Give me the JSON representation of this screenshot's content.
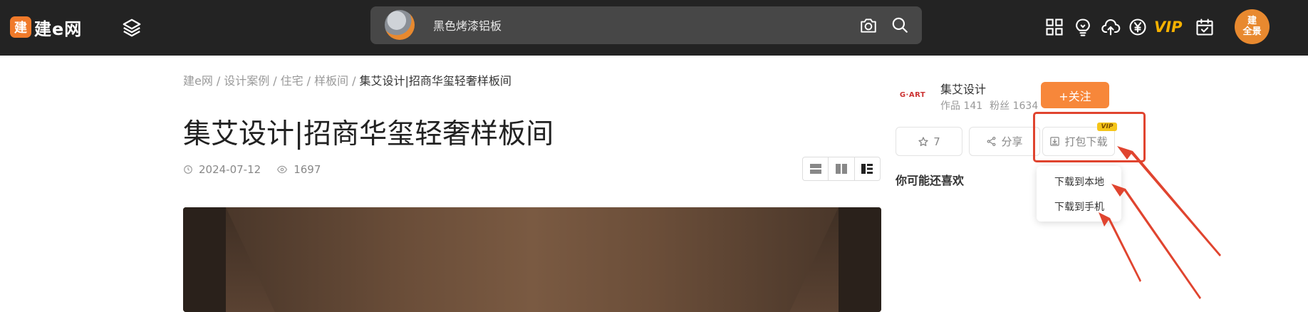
{
  "header": {
    "logo_mark": "建",
    "logo_text": "建e网",
    "search_value": "黑色烤漆铝板",
    "vip_label": "VIP",
    "avatar_text_line1": "建",
    "avatar_text_line2": "全景"
  },
  "breadcrumb": {
    "items": [
      "建e网",
      "设计案例",
      "住宅",
      "样板间"
    ],
    "current": "集艾设计|招商华玺轻奢样板间",
    "separator": "/"
  },
  "article": {
    "title": "集艾设计|招商华玺轻奢样板间",
    "date": "2024-07-12",
    "views": "1697"
  },
  "author": {
    "logo_text": "G·ART",
    "name": "集艾设计",
    "works_label": "作品 141",
    "fans_label": "粉丝 1634",
    "follow_label": "+关注"
  },
  "actions": {
    "star_count": "7",
    "share_label": "分享",
    "download_label": "打包下载",
    "vip_badge": "VIP"
  },
  "dropdown": {
    "items": [
      "下载到本地",
      "下载到手机"
    ]
  },
  "sidebar": {
    "recommend_title": "你可能还喜欢"
  },
  "colors": {
    "topbar": "#232323",
    "accent_orange": "#f7873a",
    "annotation_red": "#e0442f",
    "vip_gold": "#f5b100"
  }
}
